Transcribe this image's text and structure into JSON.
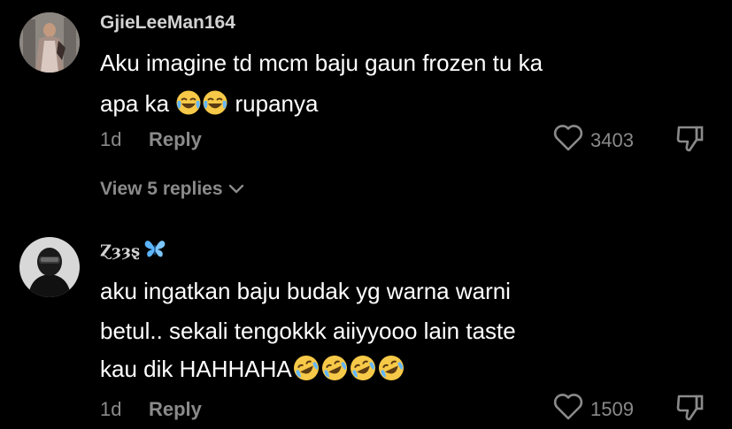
{
  "comments": [
    {
      "username": "GjieLeeMan164",
      "text_line1": "Aku imagine td mcm baju gaun frozen tu ka",
      "text_line2_pre": "apa ka ",
      "text_line2_post": " rupanya",
      "emoji_1": "face-with-tears-of-joy",
      "time": "1d",
      "reply_label": "Reply",
      "likes": "3403",
      "view_replies": "View 5 replies"
    },
    {
      "username": "Ɀȝȝȿ",
      "username_emoji": "butterfly",
      "text_line1": "aku ingatkan baju budak yg warna warni",
      "text_line2": "betul.. sekali tengokkk aiiyyooo lain taste",
      "text_line3": "kau dik HAHHAHA",
      "emoji_2": "rolling-on-the-floor-laughing",
      "time": "1d",
      "reply_label": "Reply",
      "likes": "1509"
    }
  ],
  "colors": {
    "background": "#000000",
    "text": "#ffffff",
    "muted": "#8a8a8a",
    "username": "#d2d2d2",
    "butterfly": "#5ab4ff"
  }
}
